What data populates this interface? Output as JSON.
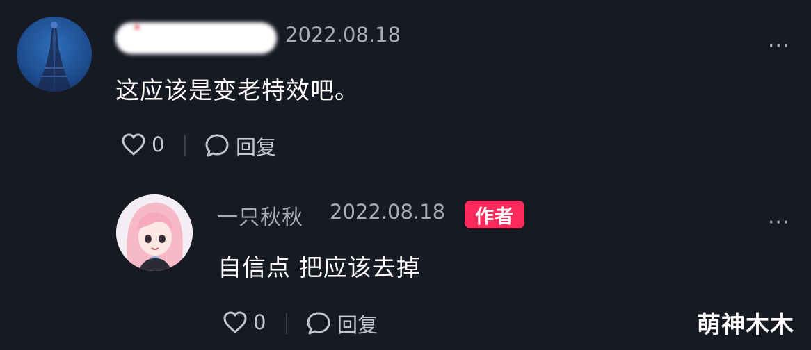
{
  "comments": [
    {
      "username": "",
      "date": "2022.08.18",
      "text": "这应该是变老特效吧。",
      "likes": "0",
      "reply_label": "回复",
      "more": "···"
    },
    {
      "username": "一只秋秋",
      "date": "2022.08.18",
      "badge": "作者",
      "text": "自信点 把应该去掉",
      "likes": "0",
      "reply_label": "回复",
      "more": "···"
    }
  ],
  "icons": {
    "like": "heart-outline-icon",
    "reply": "speech-bubble-icon"
  },
  "colors": {
    "background": "#171923",
    "secondary_text": "#a9abb5",
    "badge": "#ff2a5c"
  },
  "watermark": "萌神木木"
}
